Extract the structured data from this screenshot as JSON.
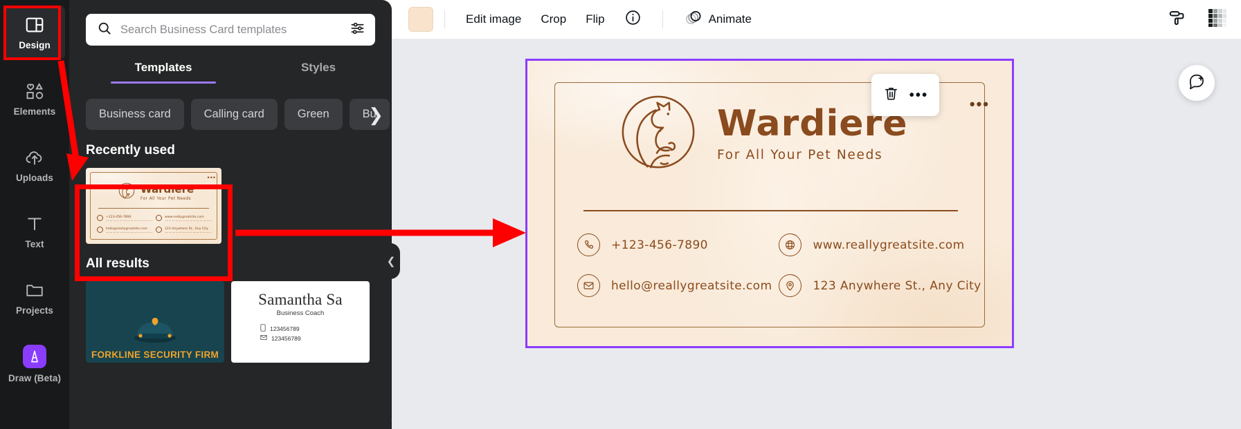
{
  "rail": {
    "items": [
      {
        "label": "Design",
        "icon": "layout-icon",
        "active": true
      },
      {
        "label": "Elements",
        "icon": "shapes-icon",
        "active": false
      },
      {
        "label": "Uploads",
        "icon": "cloud-upload-icon",
        "active": false
      },
      {
        "label": "Text",
        "icon": "text-t-icon",
        "active": false
      },
      {
        "label": "Projects",
        "icon": "folder-icon",
        "active": false
      },
      {
        "label": "Draw (Beta)",
        "icon": "draw-pen-icon",
        "active": false
      }
    ]
  },
  "panel": {
    "search": {
      "placeholder": "Search Business Card templates",
      "value": "",
      "search_icon": "search-icon",
      "filter_icon": "sliders-icon"
    },
    "tabs": [
      {
        "label": "Templates",
        "active": true
      },
      {
        "label": "Styles",
        "active": false
      }
    ],
    "chips": [
      "Business card",
      "Calling card",
      "Green",
      "Bu"
    ],
    "chips_next_icon": "chevron-right-icon",
    "recently_used_title": "Recently used",
    "all_results_title": "All results",
    "collapse_icon": "chevron-left-icon",
    "recent_thumb": {
      "brand_name": "Wardiere",
      "tagline": "For All Your Pet Needs",
      "phone": "+123-456-7890",
      "website": "www.reallygreatsite.com",
      "email": "hello@reallygreatsite.com",
      "address": "123 Anywhere St., Any City"
    },
    "results": [
      {
        "type": "dark",
        "title": "FORKLINE SECURITY FIRM",
        "bg_color": "#17444f",
        "accent_color": "#f0a32a"
      },
      {
        "type": "light",
        "name": "Samantha Sa",
        "role": "Business Coach",
        "phone": "123456789",
        "email": "123456789"
      }
    ]
  },
  "toolbar": {
    "color_swatch": "#fae3cd",
    "edit_image": "Edit image",
    "crop": "Crop",
    "flip": "Flip",
    "info_icon": "info-circle-icon",
    "animate": "Animate",
    "animate_icon": "animate-circles-icon",
    "paint_roller_icon": "paint-roller-icon",
    "transparency_icon": "checkerboard-icon"
  },
  "float_toolbar": {
    "delete_icon": "trash-icon",
    "more_icon": "more-horizontal-icon"
  },
  "canvas": {
    "comment_icon": "comment-plus-icon",
    "design_more_icon": "more-horizontal-icon",
    "card": {
      "brand_name": "Wardiere",
      "tagline": "For All Your Pet Needs",
      "logo_icon": "pet-cat-circle-icon",
      "contacts": [
        {
          "icon": "phone-icon",
          "text": "+123-456-7890"
        },
        {
          "icon": "globe-icon",
          "text": "www.reallygreatsite.com"
        },
        {
          "icon": "envelope-icon",
          "text": "hello@reallygreatsite.com"
        },
        {
          "icon": "location-pin-icon",
          "text": "123 Anywhere St., Any City"
        }
      ]
    }
  },
  "annotations": {
    "highlight_color": "#ff0000",
    "boxes": [
      "design-rail-button",
      "recently-used-thumbnail"
    ],
    "arrows": [
      "design-to-thumbnail",
      "thumbnail-to-canvas"
    ]
  }
}
